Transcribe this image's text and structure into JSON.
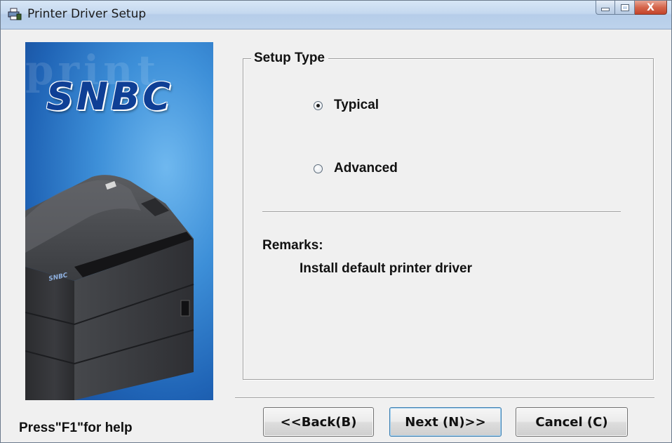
{
  "window": {
    "title": "Printer Driver Setup",
    "close_glyph": "X"
  },
  "banner": {
    "ghost_text": "print",
    "logo_text": "SNBC",
    "printer_logo": "SNBC"
  },
  "setup_type": {
    "legend": "Setup Type",
    "options": [
      {
        "label": "Typical",
        "checked": true
      },
      {
        "label": "Advanced",
        "checked": false
      }
    ]
  },
  "remarks": {
    "label": "Remarks:",
    "text": "Install default printer driver"
  },
  "footer": {
    "help_text": "Press\"F1\"for help",
    "back_label": "<<Back(B)",
    "next_label": "Next (N)>>",
    "cancel_label": "Cancel (C)"
  },
  "icons": {
    "app": "printer-setup-icon",
    "minimize": "minimize-icon",
    "maximize": "maximize-icon",
    "close": "close-icon"
  },
  "colors": {
    "banner_blue": "#1f63b5",
    "logo_blue": "#0f3f95",
    "titlebar": "#c4d8ef",
    "close_red": "#c3432a"
  }
}
